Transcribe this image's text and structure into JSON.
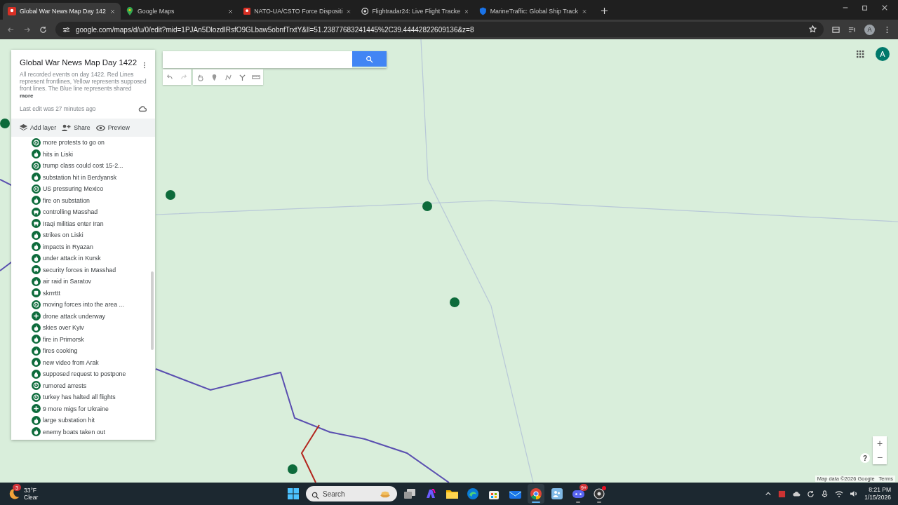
{
  "browser": {
    "tabs": [
      {
        "title": "Global War News Map Day 142",
        "kind": "pin",
        "selected": true
      },
      {
        "title": "Google Maps",
        "kind": "maps",
        "selected": false
      },
      {
        "title": "NATO-UA/CSTO Force Dispositi",
        "kind": "pin",
        "selected": false
      },
      {
        "title": "Flightradar24: Live Flight Tracke",
        "kind": "radar",
        "selected": false
      },
      {
        "title": "MarineTraffic: Global Ship Track",
        "kind": "shield",
        "selected": false
      }
    ],
    "address": "google.com/maps/d/u/0/edit?mid=1PJAn5DlozdIRsfO9GLbaw5obnfTrxtY&ll=51.23877683241445%2C39.44442822609136&z=8",
    "profile_initial": "A"
  },
  "sidebar": {
    "title": "Global War News Map Day 1422",
    "description": "All recorded events on day 1422. Red Lines represent frontlines, Yellow represents supposed front lines. The Blue line represents shared",
    "more": "more",
    "last_edit": "Last edit was 27 minutes ago",
    "actions": [
      {
        "label": "Add layer",
        "kind": "layers"
      },
      {
        "label": "Share",
        "kind": "share"
      },
      {
        "label": "Preview",
        "kind": "preview"
      }
    ],
    "items": [
      {
        "label": "more protests to go on",
        "kind": "globe"
      },
      {
        "label": "hits in Liski",
        "kind": "fire"
      },
      {
        "label": "trump class could cost 15-2...",
        "kind": "globe"
      },
      {
        "label": "substation hit in Berdyansk",
        "kind": "fire"
      },
      {
        "label": "US pressuring Mexico",
        "kind": "globe"
      },
      {
        "label": "fire on substation",
        "kind": "fire"
      },
      {
        "label": "controlling Masshad",
        "kind": "truck"
      },
      {
        "label": "Iraqi militias enter Iran",
        "kind": "truck"
      },
      {
        "label": "strikes on Liski",
        "kind": "fire"
      },
      {
        "label": "impacts in Ryazan",
        "kind": "fire"
      },
      {
        "label": "under attack in Kursk",
        "kind": "fire"
      },
      {
        "label": "security forces in Masshad",
        "kind": "truck"
      },
      {
        "label": "air raid in Saratov",
        "kind": "fire"
      },
      {
        "label": "skrrrttt",
        "kind": "square"
      },
      {
        "label": "moving forces into the area ...",
        "kind": "globe"
      },
      {
        "label": "drone attack underway",
        "kind": "plus"
      },
      {
        "label": "skies over Kyiv",
        "kind": "fire"
      },
      {
        "label": "fire in Primorsk",
        "kind": "fire"
      },
      {
        "label": "fires cooking",
        "kind": "fire"
      },
      {
        "label": "new video from Arak",
        "kind": "drop"
      },
      {
        "label": "supposed request to postpone",
        "kind": "drop"
      },
      {
        "label": "rumored arrests",
        "kind": "globe"
      },
      {
        "label": "turkey has halted all flights",
        "kind": "globe"
      },
      {
        "label": "9 more migs for Ukraine",
        "kind": "plus"
      },
      {
        "label": "large substation hit",
        "kind": "fire"
      },
      {
        "label": "enemy boats taken out",
        "kind": "fire"
      }
    ]
  },
  "map": {
    "account_initial": "A",
    "zoom_in": "+",
    "zoom_out": "−",
    "help": "?",
    "attribution": "Map data ©2026 Google",
    "terms": "Terms"
  },
  "taskbar": {
    "weather": {
      "temperature": "33°F",
      "condition": "Clear",
      "badge": "3"
    },
    "search_placeholder": "Search",
    "apps": [
      {
        "kind": "taskview",
        "active": false,
        "running": false,
        "alert": false
      },
      {
        "kind": "copilot",
        "active": false,
        "running": false,
        "alert": false
      },
      {
        "kind": "folder",
        "active": false,
        "running": false,
        "alert": false
      },
      {
        "kind": "wave",
        "active": false,
        "running": false,
        "alert": false
      },
      {
        "kind": "store",
        "active": false,
        "running": false,
        "alert": false
      },
      {
        "kind": "mail",
        "active": false,
        "running": false,
        "alert": false
      },
      {
        "kind": "browser",
        "active": true,
        "running": true,
        "alert": false
      },
      {
        "kind": "people",
        "active": false,
        "running": false,
        "alert": false
      },
      {
        "kind": "chat",
        "active": false,
        "running": true,
        "alert": false,
        "badge": "9+"
      },
      {
        "kind": "ring",
        "active": false,
        "running": true,
        "alert": true
      }
    ],
    "time": "8:21 PM",
    "date": "1/15/2026"
  }
}
